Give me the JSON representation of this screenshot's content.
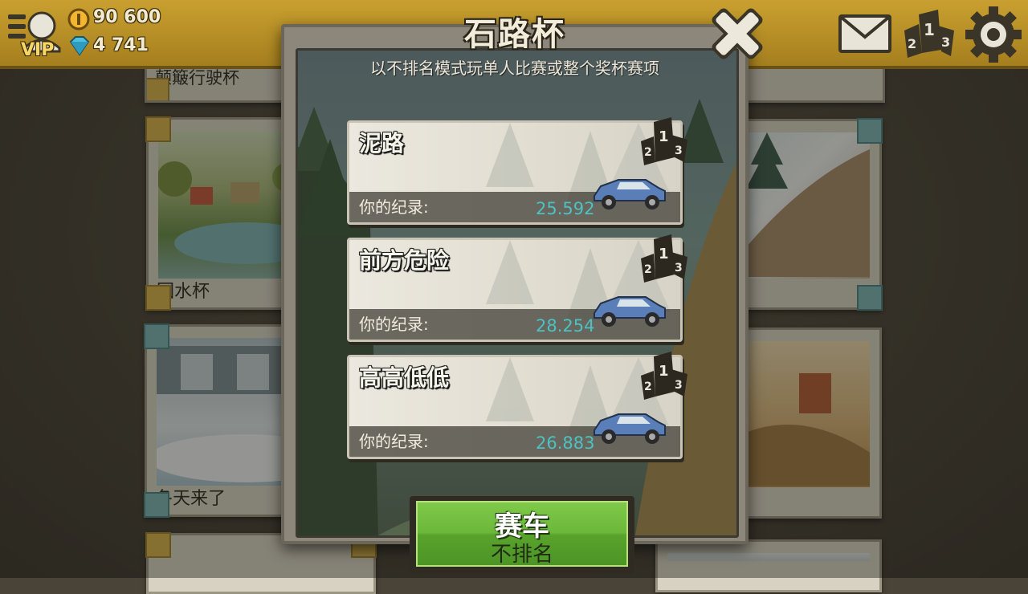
{
  "hud": {
    "coins": "90 600",
    "gems": "4 741",
    "vip_label": "VIP"
  },
  "background_cards": {
    "top_label": "颠簸行驶杯",
    "left_middle": "回水杯",
    "left_lower": "冬天来了"
  },
  "modal": {
    "title": "石路杯",
    "subtitle": "以不排名模式玩单人比赛或整个奖杯赛项",
    "record_label": "你的纪录:",
    "tracks": [
      {
        "name": "泥路",
        "record": "25.592"
      },
      {
        "name": "前方危险",
        "record": "28.254"
      },
      {
        "name": "高高低低",
        "record": "26.883"
      }
    ]
  },
  "race_button": {
    "line1": "赛车",
    "line2": "不排名"
  },
  "colors": {
    "topbar": "#c9a02f",
    "record_value": "#4cc2c2",
    "race_button": "#6bb83a",
    "modal_frame": "#8c877a"
  },
  "icons": [
    "profile-icon",
    "coin-icon",
    "gem-icon",
    "close-icon",
    "mail-icon",
    "leaderboard-icon",
    "gear-icon",
    "podium-icon",
    "car-icon"
  ]
}
